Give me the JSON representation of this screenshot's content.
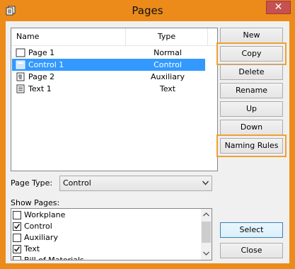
{
  "window": {
    "title": "Pages",
    "close_glyph": "✕"
  },
  "list": {
    "columns": {
      "name": "Name",
      "type": "Type"
    },
    "rows": [
      {
        "name": "Page 1",
        "type": "Normal",
        "icon": "blank-page-icon"
      },
      {
        "name": "Control 1",
        "type": "Control",
        "icon": "control-page-icon"
      },
      {
        "name": "Page 2",
        "type": "Auxiliary",
        "icon": "aux-page-icon"
      },
      {
        "name": "Text 1",
        "type": "Text",
        "icon": "text-page-icon"
      }
    ],
    "selected": "Control 1"
  },
  "buttons": {
    "new": "New",
    "copy": "Copy",
    "delete": "Delete",
    "rename": "Rename",
    "up": "Up",
    "down": "Down",
    "naming_rules": "Naming Rules",
    "select": "Select",
    "close": "Close"
  },
  "page_type": {
    "label": "Page Type:",
    "value": "Control"
  },
  "show_pages": {
    "label": "Show Pages:",
    "items": [
      {
        "label": "Workplane",
        "checked": false
      },
      {
        "label": "Control",
        "checked": true
      },
      {
        "label": "Auxiliary",
        "checked": false
      },
      {
        "label": "Text",
        "checked": true
      },
      {
        "label": "Bill of Materials",
        "checked": false
      }
    ]
  },
  "colors": {
    "accent": "#ec8b1a",
    "selection": "#3399ff",
    "highlight_outline": "#f0a030"
  }
}
